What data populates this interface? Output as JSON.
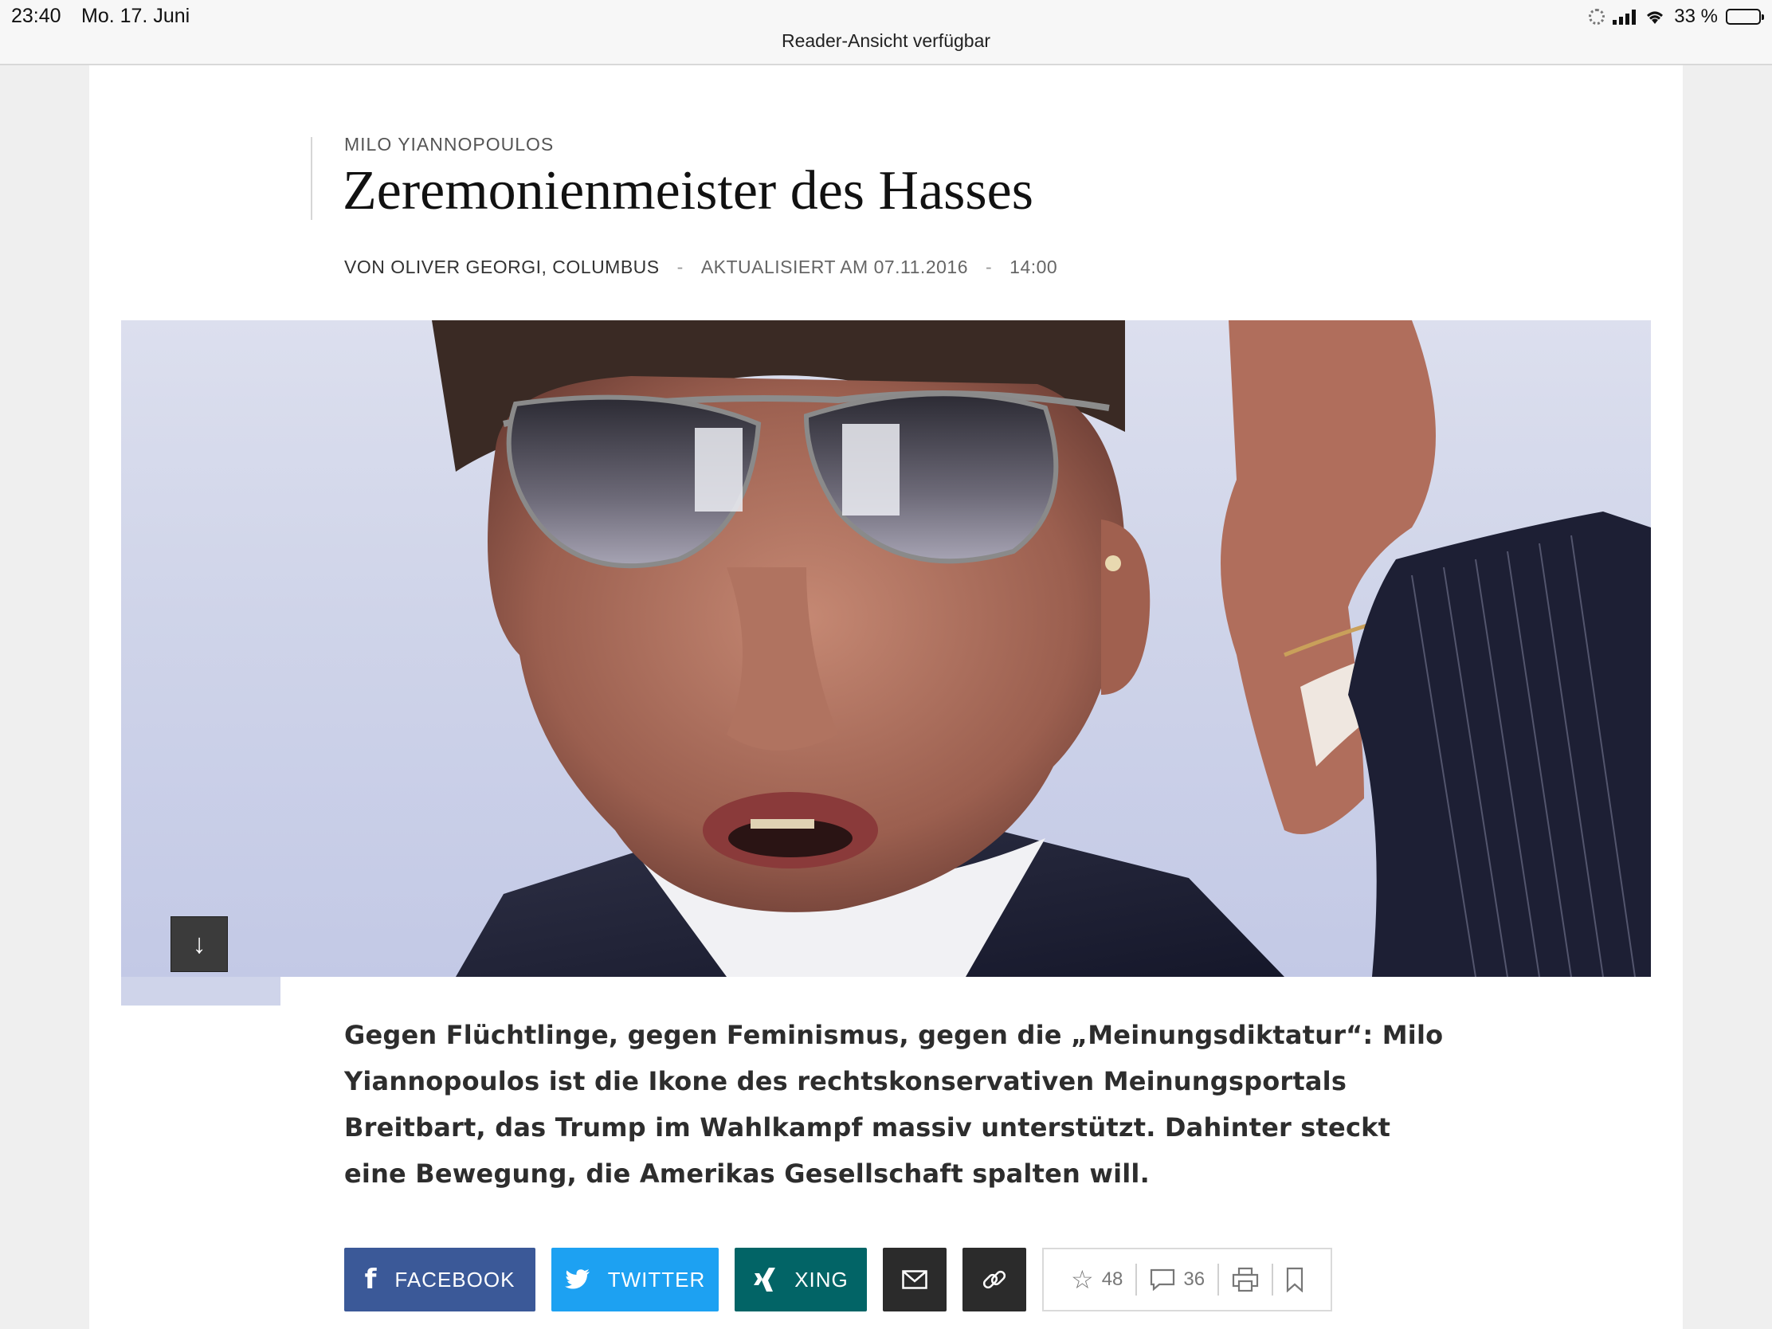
{
  "status_bar": {
    "time": "23:40",
    "date": "Mo. 17. Juni",
    "reader_hint": "Reader-Ansicht verfügbar",
    "battery": "33 %",
    "battery_level": 0.33
  },
  "article": {
    "kicker": "MILO YIANNOPOULOS",
    "headline": "Zeremonienmeister des Hasses",
    "author": "VON OLIVER GEORGI, COLUMBUS",
    "separator": "-",
    "updated": "AKTUALISIERT AM 07.11.2016",
    "time": "14:00",
    "scroll_down_glyph": "↓",
    "teaser": "Gegen Flüchtlinge, gegen Feminismus, gegen die „Meinungsdiktatur“: Milo Yiannopoulos ist die Ikone des rechtskonservativen Meinungsportals Breitbart, das Trump im Wahlkampf massiv unterstützt. Dahinter steckt eine Bewegung, die Amerikas Gesellschaft spalten will."
  },
  "share": {
    "facebook": {
      "icon": "f",
      "label": "FACEBOOK"
    },
    "twitter": {
      "icon": "twitter-bird",
      "label": "TWITTER"
    },
    "xing": {
      "icon": "xing-x",
      "label": "XING"
    },
    "email_icon": "mail-icon",
    "link_icon": "link-icon",
    "rating_count": "48",
    "comment_count": "36"
  },
  "colors": {
    "facebook": "#3b5998",
    "twitter": "#1da1f2",
    "xing": "#026466",
    "dark_button": "#2b2b2b"
  }
}
